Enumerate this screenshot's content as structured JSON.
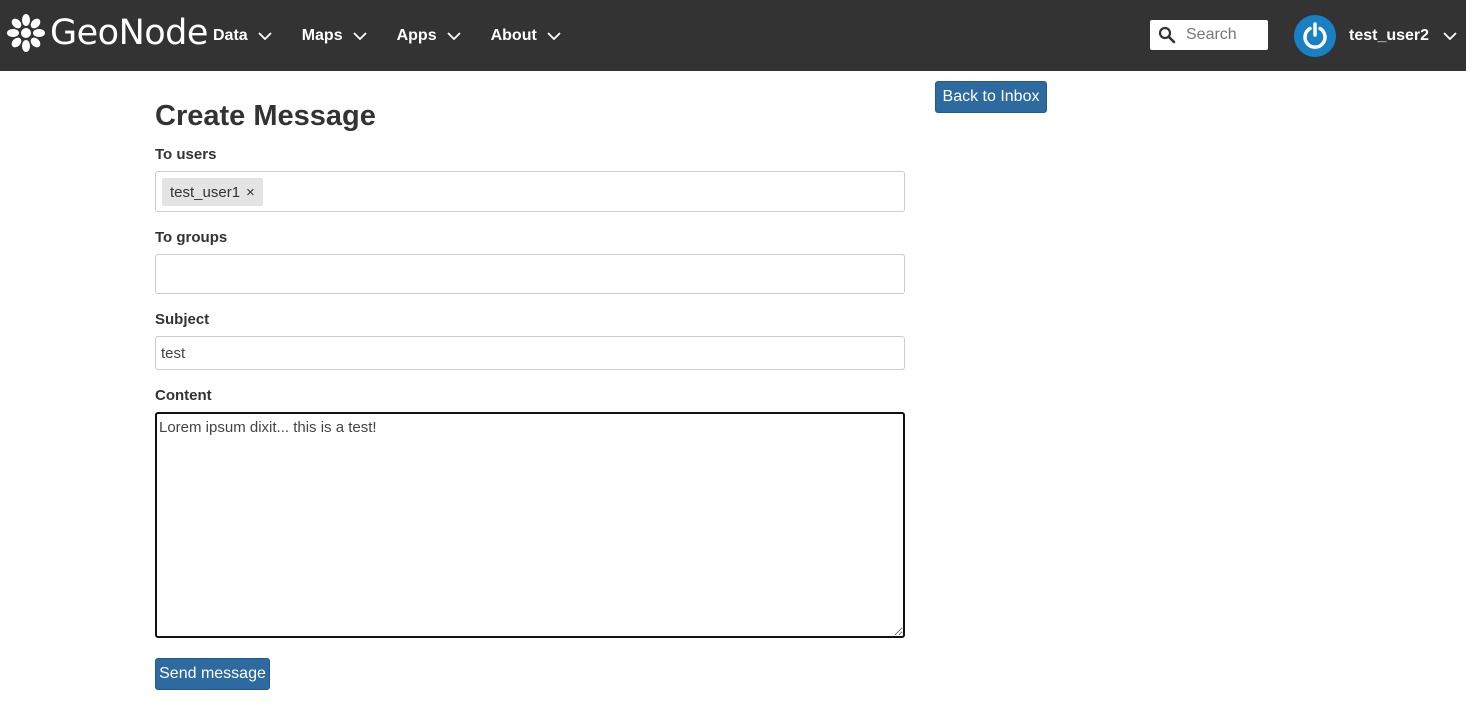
{
  "navbar": {
    "brand": "GeoNode",
    "menu": [
      {
        "label": "Data"
      },
      {
        "label": "Maps"
      },
      {
        "label": "Apps"
      },
      {
        "label": "About"
      }
    ],
    "search_placeholder": "Search",
    "user": "test_user2"
  },
  "page": {
    "title": "Create Message",
    "back_button": "Back to Inbox",
    "to_users_label": "To users",
    "to_users_tags": [
      "test_user1"
    ],
    "tag_remove": "×",
    "to_groups_label": "To groups",
    "subject_label": "Subject",
    "subject_value": "test",
    "content_label": "Content",
    "content_value": "Lorem ipsum dixit... this is a test!",
    "send_button": "Send message"
  },
  "colors": {
    "navbar_bg": "#333333",
    "button_primary": "#2c6aa0",
    "avatar_bg": "#1a80c4"
  }
}
